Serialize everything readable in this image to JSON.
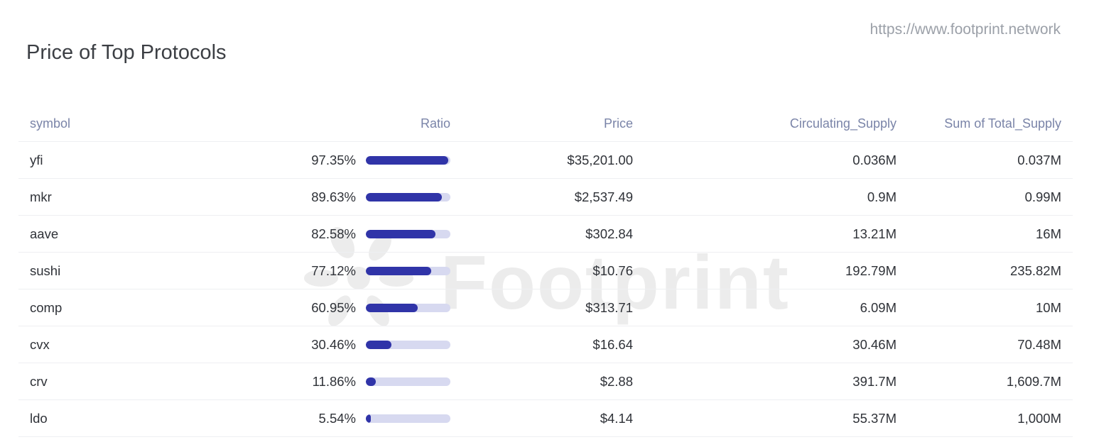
{
  "header": {
    "title": "Price of Top Protocols",
    "source_url": "https://www.footprint.network",
    "watermark": "Footprint"
  },
  "colors": {
    "bar_fill": "#3034a8",
    "bar_track": "#d7d9f0",
    "header_text": "#7a84a8",
    "cell_text": "#2f3238"
  },
  "table": {
    "columns": [
      "symbol",
      "Ratio",
      "Price",
      "Circulating_Supply",
      "Sum of Total_Supply"
    ],
    "rows": [
      {
        "symbol": "yfi",
        "ratio": "97.35%",
        "ratio_value": 0.9735,
        "price": "$35,201.00",
        "circulating_supply": "0.036M",
        "total_supply": "0.037M"
      },
      {
        "symbol": "mkr",
        "ratio": "89.63%",
        "ratio_value": 0.8963,
        "price": "$2,537.49",
        "circulating_supply": "0.9M",
        "total_supply": "0.99M"
      },
      {
        "symbol": "aave",
        "ratio": "82.58%",
        "ratio_value": 0.8258,
        "price": "$302.84",
        "circulating_supply": "13.21M",
        "total_supply": "16M"
      },
      {
        "symbol": "sushi",
        "ratio": "77.12%",
        "ratio_value": 0.7712,
        "price": "$10.76",
        "circulating_supply": "192.79M",
        "total_supply": "235.82M"
      },
      {
        "symbol": "comp",
        "ratio": "60.95%",
        "ratio_value": 0.6095,
        "price": "$313.71",
        "circulating_supply": "6.09M",
        "total_supply": "10M"
      },
      {
        "symbol": "cvx",
        "ratio": "30.46%",
        "ratio_value": 0.3046,
        "price": "$16.64",
        "circulating_supply": "30.46M",
        "total_supply": "70.48M"
      },
      {
        "symbol": "crv",
        "ratio": "11.86%",
        "ratio_value": 0.1186,
        "price": "$2.88",
        "circulating_supply": "391.7M",
        "total_supply": "1,609.7M"
      },
      {
        "symbol": "ldo",
        "ratio": "5.54%",
        "ratio_value": 0.0554,
        "price": "$4.14",
        "circulating_supply": "55.37M",
        "total_supply": "1,000M"
      }
    ]
  },
  "chart_data": {
    "type": "table",
    "columns": [
      "symbol",
      "Ratio",
      "Price",
      "Circulating_Supply",
      "Sum of Total_Supply"
    ],
    "rows": [
      [
        "yfi",
        "97.35%",
        "$35,201.00",
        "0.036M",
        "0.037M"
      ],
      [
        "mkr",
        "89.63%",
        "$2,537.49",
        "0.9M",
        "0.99M"
      ],
      [
        "aave",
        "82.58%",
        "$302.84",
        "13.21M",
        "16M"
      ],
      [
        "sushi",
        "77.12%",
        "$10.76",
        "192.79M",
        "235.82M"
      ],
      [
        "comp",
        "60.95%",
        "$313.71",
        "6.09M",
        "10M"
      ],
      [
        "cvx",
        "30.46%",
        "$16.64",
        "30.46M",
        "70.48M"
      ],
      [
        "crv",
        "11.86%",
        "$2.88",
        "391.7M",
        "1,609.7M"
      ],
      [
        "ldo",
        "5.54%",
        "$4.14",
        "55.37M",
        "1,000M"
      ]
    ],
    "title": "Price of Top Protocols"
  }
}
